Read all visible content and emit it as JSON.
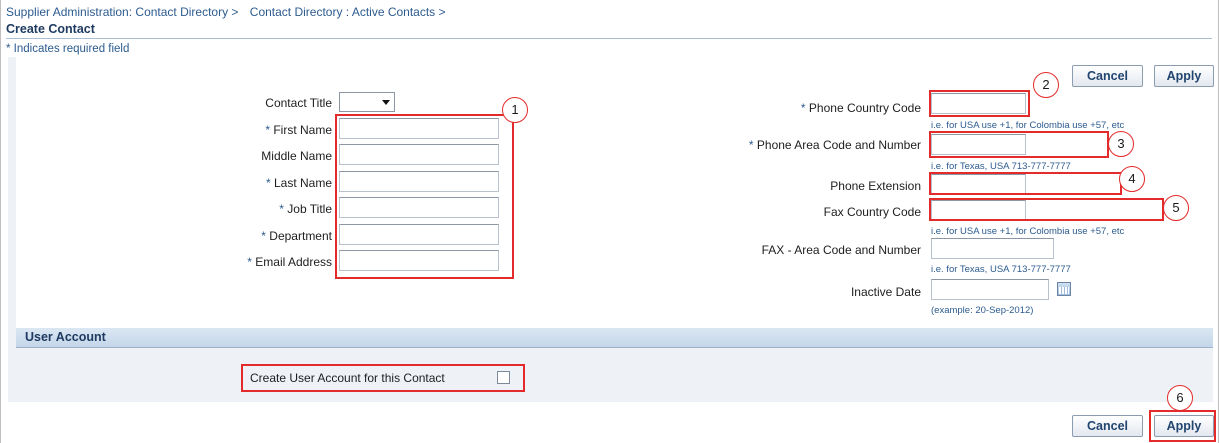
{
  "breadcrumb": {
    "crumb1": "Supplier Administration: Contact Directory >",
    "crumb2": "Contact Directory : Active Contacts >"
  },
  "page": {
    "title": "Create Contact",
    "required_note": "* Indicates required field"
  },
  "buttons": {
    "cancel": "Cancel",
    "apply": "Apply"
  },
  "left_fields": {
    "contact_title": {
      "label": "Contact Title",
      "required": false,
      "value": ""
    },
    "first_name": {
      "label": "First Name",
      "required": true,
      "value": ""
    },
    "middle_name": {
      "label": "Middle Name",
      "required": false,
      "value": ""
    },
    "last_name": {
      "label": "Last Name",
      "required": true,
      "value": ""
    },
    "job_title": {
      "label": "Job Title",
      "required": true,
      "value": ""
    },
    "department": {
      "label": "Department",
      "required": true,
      "value": ""
    },
    "email_address": {
      "label": "Email Address",
      "required": true,
      "value": ""
    }
  },
  "right_fields": {
    "phone_country_code": {
      "label": "Phone Country Code",
      "required": true,
      "hint": "i.e. for USA use +1, for Colombia use +57, etc"
    },
    "phone_area_code": {
      "label": "Phone Area Code and Number",
      "required": true,
      "hint": "i.e. for Texas, USA 713-777-7777"
    },
    "phone_extension": {
      "label": "Phone Extension",
      "required": false,
      "hint": ""
    },
    "fax_country_code": {
      "label": "Fax Country Code",
      "required": false,
      "hint": "i.e. for USA use +1, for Colombia use +57, etc"
    },
    "fax_area_code": {
      "label": "FAX - Area Code and Number",
      "required": false,
      "hint": "i.e. for Texas, USA 713-777-7777"
    },
    "inactive_date": {
      "label": "Inactive Date",
      "required": false,
      "hint": "(example: 20-Sep-2012)"
    }
  },
  "user_account": {
    "section_title": "User Account",
    "create_label": "Create User Account for this Contact",
    "checked": false
  },
  "callouts": [
    "1",
    "2",
    "3",
    "4",
    "5",
    "6"
  ],
  "colors": {
    "link_blue": "#2c5b8f",
    "heading_blue": "#1f3a60",
    "highlight_red": "#e32b2b",
    "section_bg": "#eef2f7"
  }
}
